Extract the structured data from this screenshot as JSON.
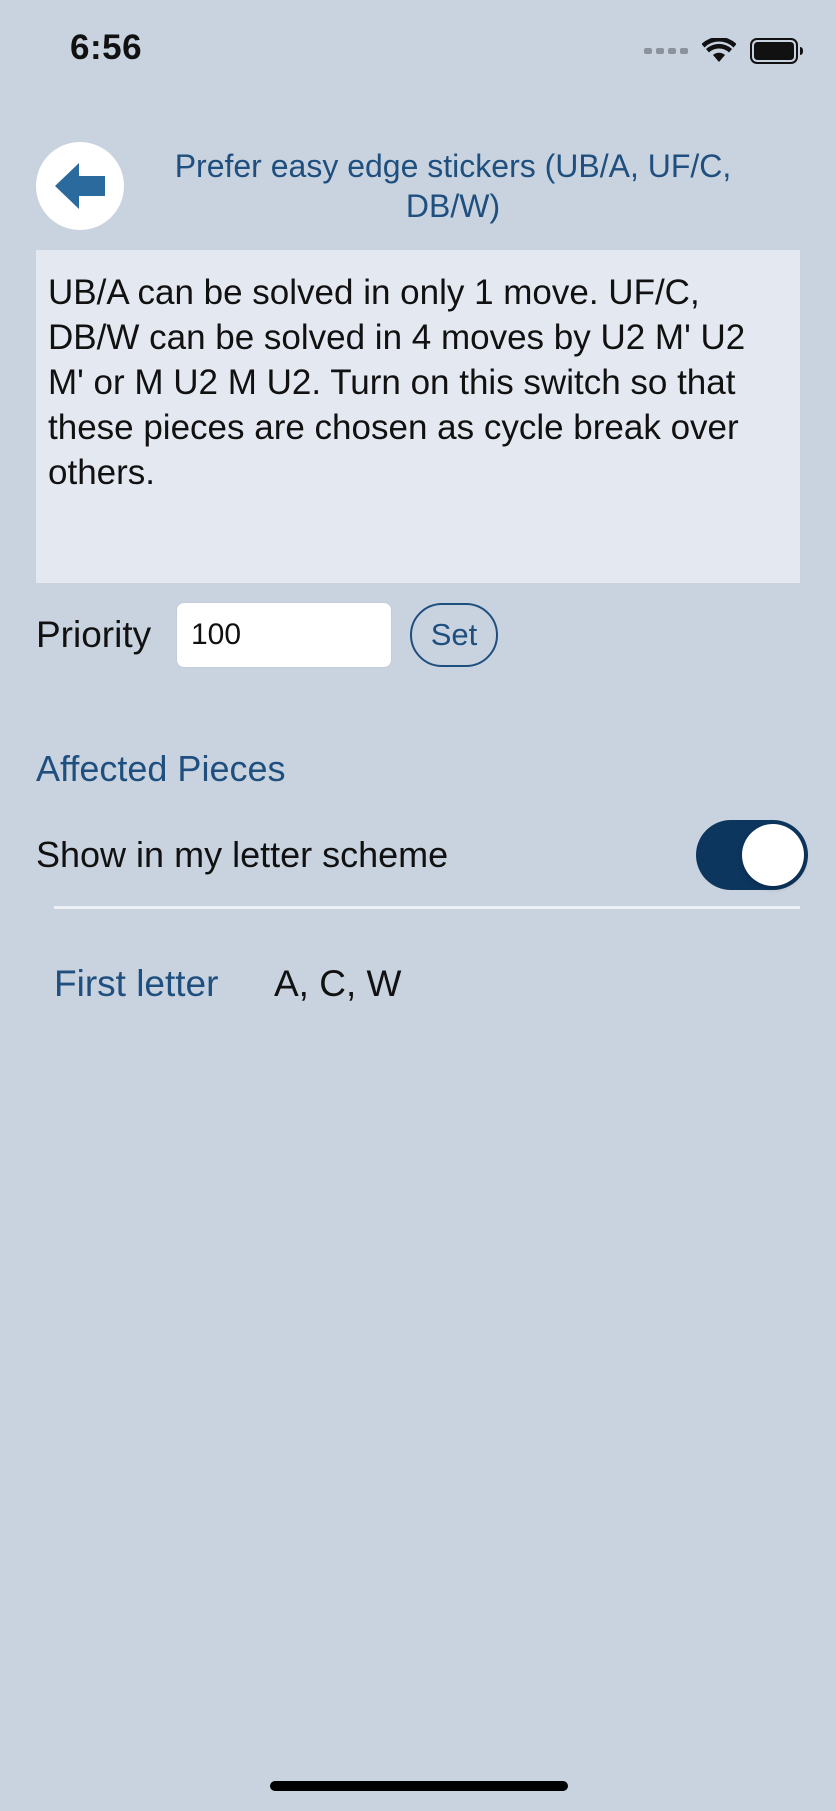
{
  "status_bar": {
    "time": "6:56",
    "icons": [
      "cellular-signal-icon",
      "wifi-icon",
      "battery-icon"
    ]
  },
  "header": {
    "back_icon": "back-arrow-icon",
    "title": "Prefer easy edge stickers (UB/A, UF/C, DB/W)"
  },
  "description": {
    "text": "UB/A can be solved in only 1 move. UF/C, DB/W can be solved in 4 moves by U2 M' U2 M' or M U2 M U2. Turn on this switch so that these pieces are chosen as cycle break over others."
  },
  "priority": {
    "label": "Priority",
    "value": "100",
    "set_label": "Set"
  },
  "affected_pieces": {
    "heading": "Affected Pieces",
    "toggle_label": "Show in my letter scheme",
    "toggle_on": true,
    "first_letter_label": "First letter",
    "first_letter_value": "A, C, W"
  },
  "colors": {
    "background": "#c9d3df",
    "accent": "#1f4f7e",
    "toggle_on": "#0d365f",
    "description_bg": "#e4e8f1"
  }
}
